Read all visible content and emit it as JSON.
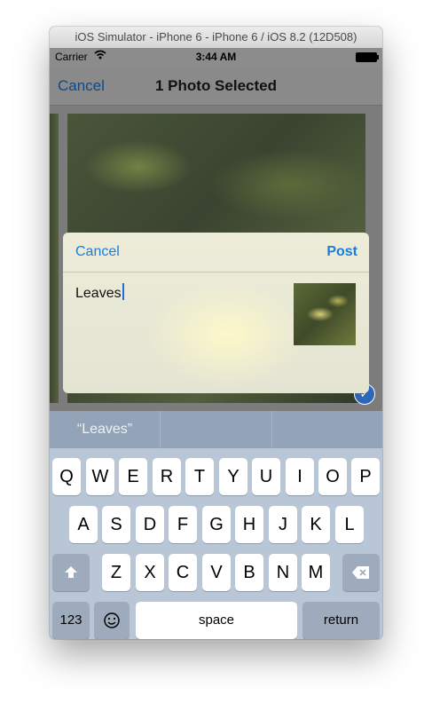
{
  "window": {
    "title": "iOS Simulator - iPhone 6 - iPhone 6 / iOS 8.2 (12D508)"
  },
  "status_bar": {
    "carrier": "Carrier",
    "time": "3:44 AM"
  },
  "nav": {
    "cancel_label": "Cancel",
    "title": "1 Photo Selected"
  },
  "share_sheet": {
    "cancel_label": "Cancel",
    "post_label": "Post",
    "text": "Leaves"
  },
  "suggestions": [
    "“Leaves”",
    "",
    ""
  ],
  "keyboard": {
    "row1": [
      "Q",
      "W",
      "E",
      "R",
      "T",
      "Y",
      "U",
      "I",
      "O",
      "P"
    ],
    "row2": [
      "A",
      "S",
      "D",
      "F",
      "G",
      "H",
      "J",
      "K",
      "L"
    ],
    "row3": [
      "Z",
      "X",
      "C",
      "V",
      "B",
      "N",
      "M"
    ],
    "numbers_label": "123",
    "space_label": "space",
    "return_label": "return"
  },
  "icons": {
    "wifi": "wifi-icon",
    "battery": "battery-icon",
    "checkmark": "checkmark-icon",
    "shift": "shift-icon",
    "delete": "delete-icon",
    "emoji": "emoji-icon"
  },
  "colors": {
    "ios_blue": "#1a7de0",
    "nav_link_blue": "#0d4a8a",
    "keyboard_bg": "#b8c6d6"
  }
}
